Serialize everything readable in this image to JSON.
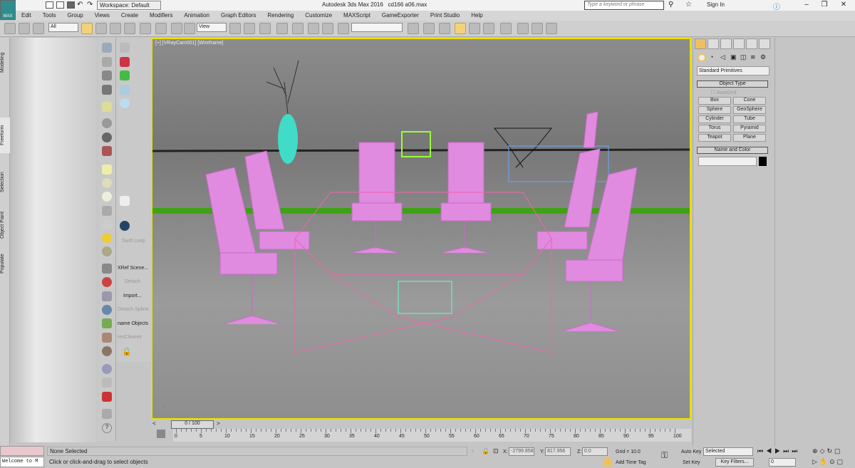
{
  "app": {
    "title": "Autodesk 3ds Max 2016",
    "file": "cd166 a06.max",
    "logo": "MAX",
    "workspace": "Workspace: Default"
  },
  "search": {
    "placeholder": "Type a keyword or phrase"
  },
  "account": {
    "sign_in": "Sign In"
  },
  "menu": [
    "Edit",
    "Tools",
    "Group",
    "Views",
    "Create",
    "Modifiers",
    "Animation",
    "Graph Editors",
    "Rendering",
    "Customize",
    "MAXScript",
    "GameExporter",
    "Print Studio",
    "Help"
  ],
  "toolbar": {
    "selection_filter": "All",
    "reference_coord": "View",
    "named_selection": ""
  },
  "ribbon_tabs": [
    "Modeling",
    "Freeform",
    "Selection",
    "Object Paint",
    "Populate"
  ],
  "command_column": [
    "Swift Loop",
    "XRef Scene...",
    "Detach",
    "Import...",
    "Detach Spline",
    "name Objects",
    "resCleaner"
  ],
  "viewport": {
    "label": "[+] [VRayCam001] [Wireframe]",
    "border_color": "#e8e000",
    "object_color": "#e08ae0"
  },
  "command_panel": {
    "category": "Standard Primitives",
    "object_type_title": "Object Type",
    "autogrid": "AutoGrid",
    "buttons": [
      "Box",
      "Cone",
      "Sphere",
      "GeoSphere",
      "Cylinder",
      "Tube",
      "Torus",
      "Pyramid",
      "Teapot",
      "Plane"
    ],
    "name_color_title": "Name and Color",
    "name_value": "",
    "color": "#000000"
  },
  "timeline": {
    "slider": "0 / 100",
    "ticks": [
      "0",
      "5",
      "10",
      "15",
      "20",
      "25",
      "30",
      "35",
      "40",
      "45",
      "50",
      "55",
      "60",
      "65",
      "70",
      "75",
      "80",
      "85",
      "90",
      "95",
      "100"
    ]
  },
  "status": {
    "maxscript_listener": "Welcome to M",
    "selection": "None Selected",
    "prompt": "Click or click-and-drag to select objects",
    "x_label": "X:",
    "x": "-2799.858",
    "y_label": "Y:",
    "y": "817.956",
    "z_label": "Z:",
    "z": "0.0",
    "grid": "Grid = 10.0",
    "add_time_tag": "Add Time Tag",
    "auto_key": "Auto Key",
    "set_key": "Set Key",
    "key_mode": "Selected",
    "key_filters": "Key Filters...",
    "frame": "0"
  }
}
